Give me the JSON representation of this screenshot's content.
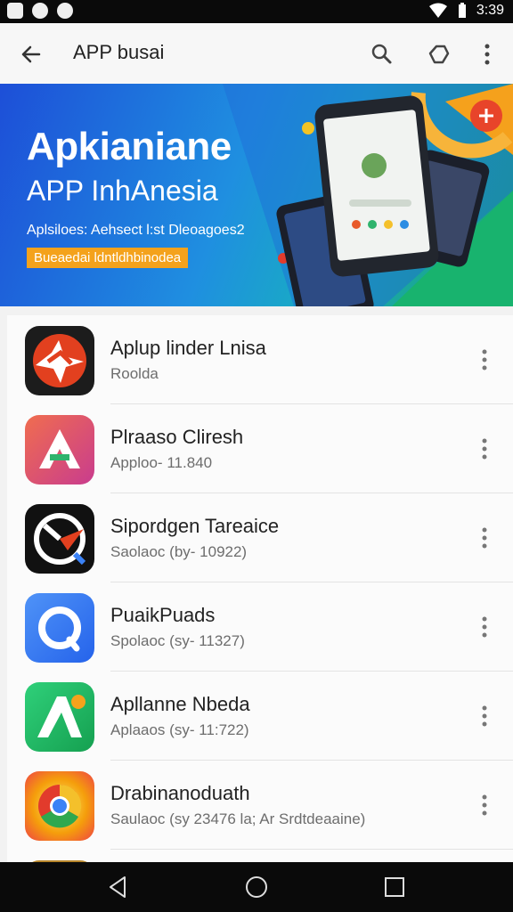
{
  "status_bar": {
    "time": "3:39"
  },
  "app_bar": {
    "title": "APP busai"
  },
  "banner": {
    "title": "Apkianiane",
    "subtitle": "APP InhAnesia",
    "tagline": "Aplsiloes: Aehsect l:st Dleoagoes2",
    "badge": "Bueaedai ldntldhbinodea"
  },
  "apps": [
    {
      "name": "Aplup linder Lnisa",
      "sub": "Roolda",
      "icon": "star-burst-app-icon",
      "colors": [
        "#e2401f",
        "#1c1c1c"
      ]
    },
    {
      "name": "Plraaso Cliresh",
      "sub": "Apploo- 11.840",
      "icon": "letter-a-app-icon",
      "colors": [
        "#f06d4f",
        "#c93c8e"
      ]
    },
    {
      "name": "Sipordgen Tareaice",
      "sub": "Saolaoc (by- 10922)",
      "icon": "compass-app-icon",
      "colors": [
        "#111111",
        "#ffffff"
      ]
    },
    {
      "name": "PuaikPuads",
      "sub": "Spolaoc (sy- 11327)",
      "icon": "ring-app-icon",
      "colors": [
        "#3b82f6",
        "#2563eb"
      ]
    },
    {
      "name": "Apllanne Nbeda",
      "sub": "Aplaaos (sy- 11:722)",
      "icon": "green-a-app-icon",
      "colors": [
        "#22c55e",
        "#15a050"
      ]
    },
    {
      "name": "Drabinanoduath",
      "sub": "Saulaoc (sy 23476 la; Ar Srdtdeaaine)",
      "icon": "chrome-like-app-icon",
      "colors": [
        "#f59e0b",
        "#ef4444"
      ]
    }
  ]
}
